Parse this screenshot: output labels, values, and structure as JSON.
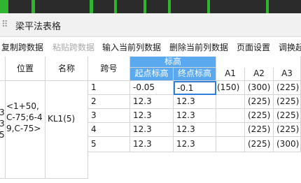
{
  "window": {
    "title": "梁平法表格"
  },
  "toolbar": {
    "copy_span": "复制跨数据",
    "paste_span": "粘贴跨数据",
    "insert_col": "输入当前列数据",
    "delete_col": "删除当前列数据",
    "page_setup": "页面设置",
    "swap": "调换起"
  },
  "table": {
    "headers": {
      "position": "位置",
      "name": "名称",
      "span_no": "跨号",
      "elevation": "标高",
      "start_elev": "起点标高",
      "end_elev": "终点标高",
      "a1": "A1",
      "a2": "A2",
      "a3": "A3"
    },
    "position_text": "<1+50,C-75;6-49,C-75>",
    "left_clip": [
      "3",
      "3",
      "5"
    ],
    "name_text": "KL1(5)",
    "rows": [
      {
        "span": "1",
        "start": "-0.05",
        "end": "-0.1",
        "a1": "(150)",
        "a2": "(300)",
        "a3": "(225)"
      },
      {
        "span": "2",
        "start": "12.3",
        "end": "12.3",
        "a1": "",
        "a2": "(225)",
        "a3": "(225)"
      },
      {
        "span": "3",
        "start": "12.3",
        "end": "12.3",
        "a1": "",
        "a2": "(225)",
        "a3": "(225)"
      },
      {
        "span": "4",
        "start": "12.3",
        "end": "12.3",
        "a1": "",
        "a2": "(225)",
        "a3": "(225)"
      },
      {
        "span": "5",
        "start": "12.3",
        "end": "12.3",
        "a1": "",
        "a2": "(225)",
        "a3": "(300)"
      }
    ]
  }
}
